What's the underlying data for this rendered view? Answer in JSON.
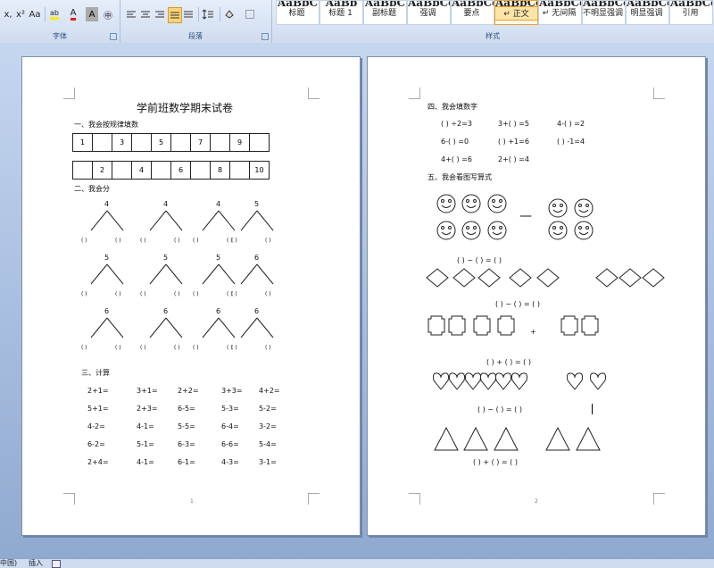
{
  "ribbon": {
    "font_group": "字体",
    "para_group": "段落",
    "style_group": "样式",
    "font_buttons": [
      "x,",
      "x²",
      "Aa",
      "ab",
      "A",
      "A",
      "㊥"
    ],
    "styles": [
      {
        "preview": "AaBbC",
        "name": "标题"
      },
      {
        "preview": "AaBb",
        "name": "标题 1"
      },
      {
        "preview": "AaBbC",
        "name": "副标题"
      },
      {
        "preview": "AaBbCcD",
        "name": "强调"
      },
      {
        "preview": "AaBbCcD",
        "name": "要点"
      },
      {
        "preview": "AaBbCcD",
        "name": "↵ 正文",
        "active": true
      },
      {
        "preview": "AaBbCcD",
        "name": "↵ 无间隔"
      },
      {
        "preview": "AaBbCcD",
        "name": "不明显强调"
      },
      {
        "preview": "AaBbCcD",
        "name": "明显强调"
      },
      {
        "preview": "AaBbCcD",
        "name": "引用"
      }
    ]
  },
  "page1": {
    "title": "学前班数学期末试卷",
    "s1": "一、我会按规律填数",
    "row1": [
      "1",
      "",
      "3",
      "",
      "5",
      "",
      "7",
      "",
      "9",
      ""
    ],
    "row2": [
      "",
      "2",
      "",
      "4",
      "",
      "6",
      "",
      "8",
      "",
      "10"
    ],
    "s2": "二、我会分",
    "split_numbers": [
      "4",
      "4",
      "4",
      "5",
      "5",
      "5",
      "5",
      "6",
      "6",
      "6",
      "6",
      "6"
    ],
    "paren": "(  )",
    "s3": "三、计算",
    "calc": [
      [
        "2+1=",
        "3+1=",
        "2+2=",
        "3+3=",
        "4+2="
      ],
      [
        "5+1=",
        "2+3=",
        "6-5=",
        "5-3=",
        "5-2="
      ],
      [
        "4-2=",
        "4-1=",
        "5-5=",
        "6-4=",
        "3-2="
      ],
      [
        "6-2=",
        "5-1=",
        "6-3=",
        "6-6=",
        "5-4="
      ],
      [
        "2+4=",
        "4-1=",
        "6-1=",
        "4-3=",
        "3-1="
      ]
    ],
    "page_num": "1"
  },
  "page2": {
    "s4": "四、我会填数字",
    "fill": [
      [
        "(    ) ÷2=3",
        "3+(    ) =5",
        "4-(    ) =2"
      ],
      [
        "6-(    ) =0",
        "(    ) +1=6",
        "(    ) -1=4"
      ],
      [
        "4+(    ) =6",
        "2+(    ) =4",
        ""
      ]
    ],
    "s5": "五、我会看图写算式",
    "dash": "—",
    "eq_minus": "(    ) − (    ) = (    )",
    "eq_plus": "(    ) + (    ) = (    )",
    "plus_sign": "+",
    "page_num": "2"
  },
  "status": {
    "lang": "中国)",
    "mode": "插入"
  }
}
